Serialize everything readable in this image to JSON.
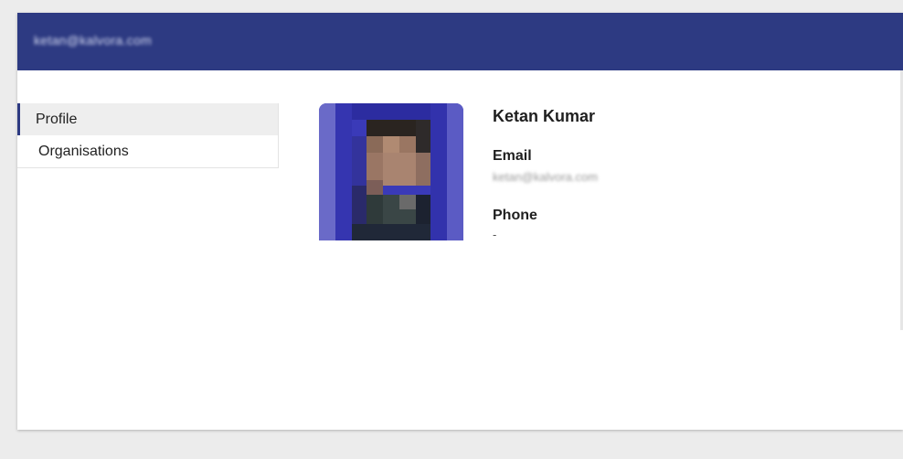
{
  "header": {
    "account_email": "ketan@kalvora.com"
  },
  "sidebar": {
    "items": [
      {
        "label": "Profile",
        "active": true
      },
      {
        "label": "Organisations",
        "active": false
      }
    ]
  },
  "profile": {
    "name": "Ketan Kumar",
    "email_label": "Email",
    "email_value": "ketan@kalvora.com",
    "phone_label": "Phone",
    "phone_value": "-"
  },
  "colors": {
    "header_bg": "#2d3a82",
    "page_bg": "#ececec",
    "active_item_bg": "#eeeeee"
  }
}
